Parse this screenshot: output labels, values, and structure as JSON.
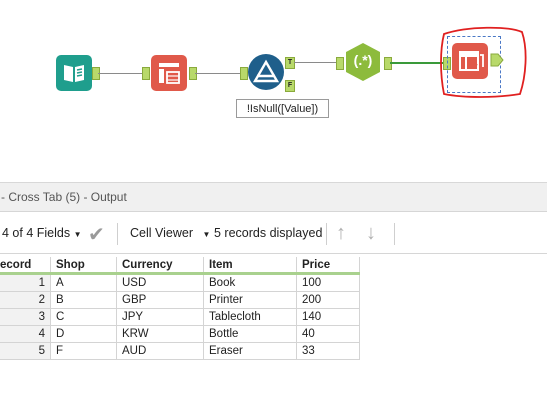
{
  "canvas": {
    "formula_label": "!IsNull([Value])",
    "true_anchor": "T",
    "false_anchor": "F",
    "regex_label": "(.*)",
    "colors": {
      "input": "#1f9e8d",
      "crosstab": "#e0594a",
      "filter": "#1f5f8b",
      "regex": "#8dbb3c",
      "selection": "#e02020"
    }
  },
  "results": {
    "title": "- Cross Tab (5) - Output",
    "fields_label": "4 of 4 Fields",
    "viewer_label": "Cell Viewer",
    "records_label": "5 records displayed",
    "columns": [
      "ecord",
      "Shop",
      "Currency",
      "Item",
      "Price"
    ],
    "rows": [
      [
        "1",
        "A",
        "USD",
        "Book",
        "100"
      ],
      [
        "2",
        "B",
        "GBP",
        "Printer",
        "200"
      ],
      [
        "3",
        "C",
        "JPY",
        "Tablecloth",
        "140"
      ],
      [
        "4",
        "D",
        "KRW",
        "Bottle",
        "40"
      ],
      [
        "5",
        "F",
        "AUD",
        "Eraser",
        "33"
      ]
    ]
  }
}
